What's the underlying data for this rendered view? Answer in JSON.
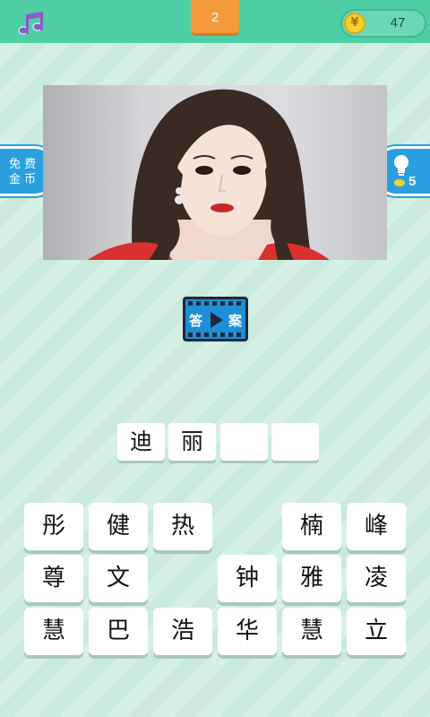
{
  "header": {
    "music_icon": "music-note-icon",
    "level": "2",
    "coins": "47",
    "coin_symbol": "¥"
  },
  "side": {
    "free_coins_line1": "免 费",
    "free_coins_line2": "金 币",
    "hint_icon": "lightbulb-icon",
    "hint_cost": "5"
  },
  "answer_button": {
    "left_char": "答",
    "right_char": "案"
  },
  "answer_slots": [
    "迪",
    "丽",
    "",
    ""
  ],
  "tiles": [
    "彤",
    "健",
    "热",
    "",
    "楠",
    "峰",
    "尊",
    "文",
    "",
    "钟",
    "雅",
    "凌",
    "慧",
    "巴",
    "浩",
    "华",
    "慧",
    "立"
  ],
  "colors": {
    "accent": "#4fcfa6",
    "level_tab": "#f39a3d",
    "side_tab": "#2a9fe0"
  }
}
